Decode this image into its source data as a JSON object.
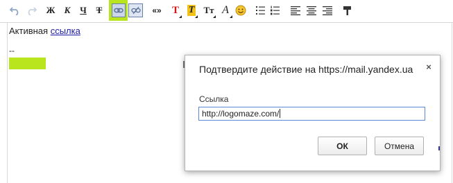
{
  "toolbar": {
    "undo_icon": "undo-icon",
    "redo_icon": "redo-icon",
    "bold_label": "Ж",
    "italic_label": "К",
    "underline_label": "Ч",
    "strike_label": "Т",
    "link_icon": "link-icon",
    "unlink_icon": "unlink-icon",
    "quote_label": "«»",
    "text_color_label": "T",
    "bg_color_label": "T",
    "font_size_label": "Tт",
    "font_family_label": "A",
    "smiley_icon": "smiley-icon",
    "bullet_list_icon": "bulleted-list-icon",
    "number_list_icon": "numbered-list-icon",
    "align_left_icon": "align-left-icon",
    "align_center_icon": "align-center-icon",
    "align_right_icon": "align-right-icon",
    "format_painter_icon": "format-painter-icon",
    "highlight_color": "#b9e51e"
  },
  "editor": {
    "text_prefix": "Активная",
    "link_text": "ссылка",
    "separator": "--"
  },
  "dialog": {
    "title": "Подтвердите действие на https://mail.yandex.ua",
    "close_label": "×",
    "field_label": "Ссылка",
    "field_value": "http://logomaze.com/",
    "ok_label": "ОК",
    "cancel_label": "Отмена"
  }
}
